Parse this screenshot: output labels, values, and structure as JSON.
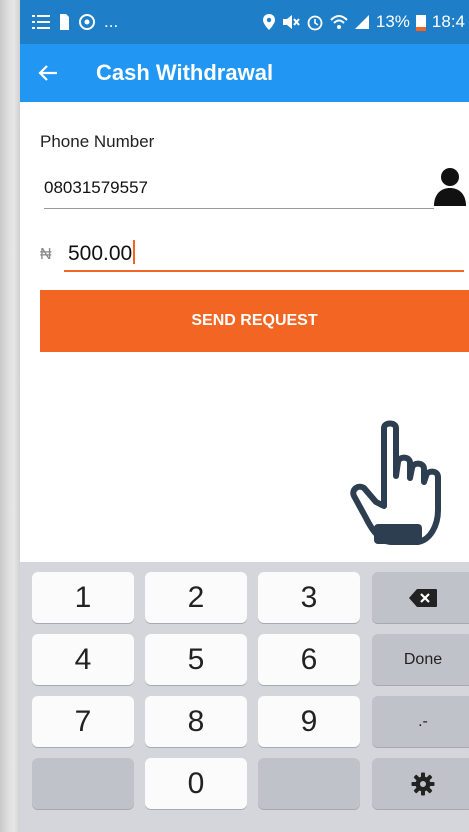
{
  "status_bar": {
    "battery": "13%",
    "time": "18:4",
    "left_more": "..."
  },
  "app_bar": {
    "title": "Cash Withdrawal"
  },
  "form": {
    "phone_label": "Phone Number",
    "phone_value": "08031579557",
    "currency_symbol": "₦",
    "amount_value": "500.00",
    "send_button": "SEND REQUEST"
  },
  "keyboard": {
    "keys": [
      "1",
      "2",
      "3",
      "4",
      "5",
      "6",
      "7",
      "8",
      "9",
      "0"
    ],
    "done_label": "Done",
    "punct_label": ".-"
  },
  "colors": {
    "status_bar": "#1e7fc8",
    "app_bar": "#2196f3",
    "accent": "#f26522",
    "keyboard_bg": "#d4d6dc"
  }
}
